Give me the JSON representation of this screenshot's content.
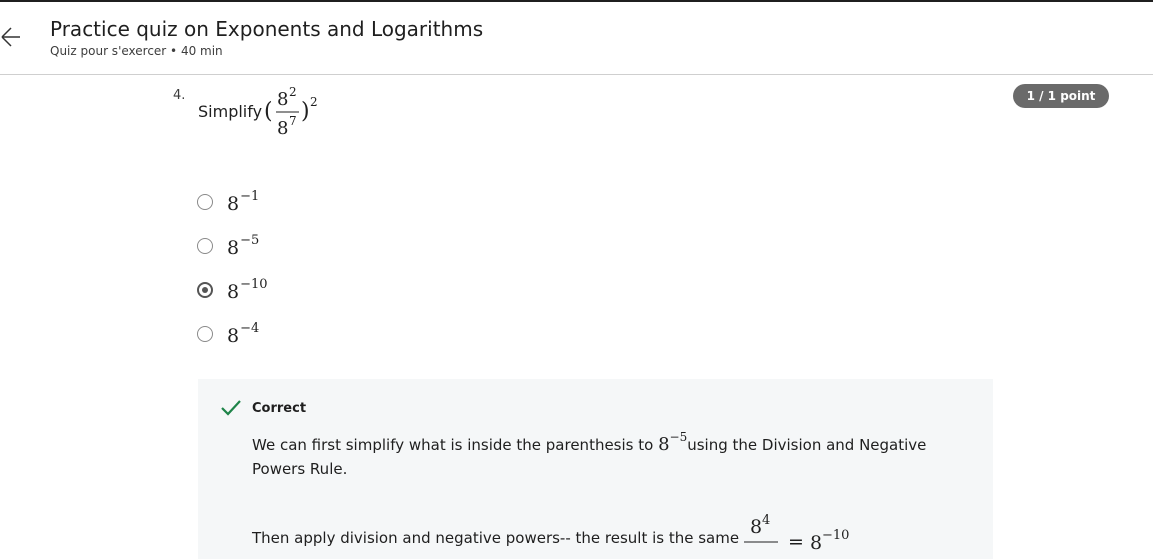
{
  "header": {
    "title": "Practice quiz on Exponents and Logarithms",
    "subtitle": "Quiz pour s'exercer • 40 min"
  },
  "question": {
    "number": "4.",
    "prompt": "Simplify",
    "expression": {
      "numerator_base": "8",
      "numerator_exp": "2",
      "denominator_base": "8",
      "denominator_exp": "7",
      "outer_exp": "2"
    },
    "score_badge": "1 / 1 point",
    "options": [
      {
        "base": "8",
        "exponent": "−1",
        "selected": false
      },
      {
        "base": "8",
        "exponent": "−5",
        "selected": false
      },
      {
        "base": "8",
        "exponent": "−10",
        "selected": true
      },
      {
        "base": "8",
        "exponent": "−4",
        "selected": false
      }
    ]
  },
  "feedback": {
    "status": "Correct",
    "text_before": "We can first simplify what is inside the parenthesis to ",
    "inline_base": "8",
    "inline_exp": "−5",
    "text_after": "using the Division and Negative Powers Rule.",
    "text2": "Then apply division and negative powers-- the result is the same",
    "expr_num_base": "8",
    "expr_num_exp": "4",
    "expr_rhs_base": "8",
    "expr_rhs_exp": "−10"
  },
  "colors": {
    "check": "#1e8449",
    "badge": "#6a6a6a",
    "feedback_bg": "#f5f7f8"
  },
  "icons": {
    "back": "arrow-left-icon",
    "check": "checkmark-icon"
  }
}
